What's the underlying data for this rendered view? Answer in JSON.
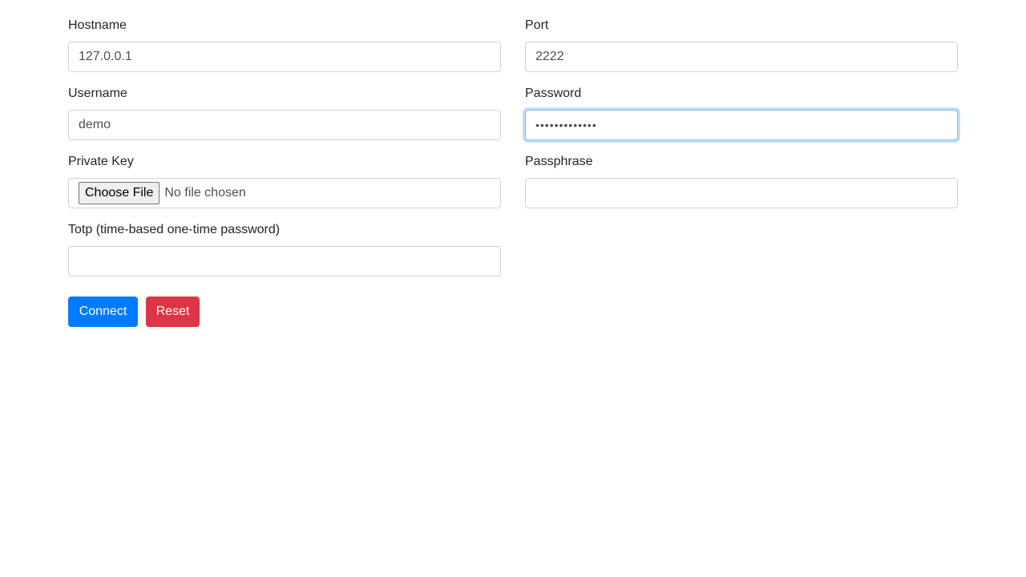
{
  "form": {
    "hostname": {
      "label": "Hostname",
      "value": "127.0.0.1"
    },
    "port": {
      "label": "Port",
      "value": "2222"
    },
    "username": {
      "label": "Username",
      "value": "demo"
    },
    "password": {
      "label": "Password",
      "value": "•••••••••••••"
    },
    "private_key": {
      "label": "Private Key",
      "button_label": "Choose File",
      "status": "No file chosen"
    },
    "passphrase": {
      "label": "Passphrase",
      "value": ""
    },
    "totp": {
      "label": "Totp (time-based one-time password)",
      "value": ""
    }
  },
  "actions": {
    "connect_label": "Connect",
    "reset_label": "Reset"
  },
  "colors": {
    "primary": "#007bff",
    "danger": "#dc3545",
    "focus_ring": "#80bdff",
    "border": "#ced4da"
  }
}
